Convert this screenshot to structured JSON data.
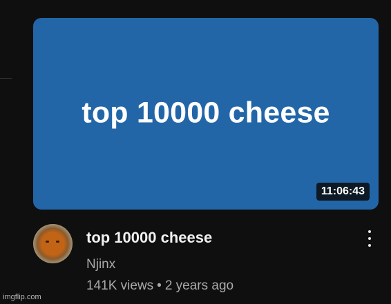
{
  "video": {
    "thumbnail_text": "top 10000 cheese",
    "thumbnail_color": "#2366a8",
    "duration": "11:06:43",
    "title": "top 10000 cheese",
    "channel": "Njinx",
    "views": "141K views",
    "separator": "•",
    "age": "2 years ago"
  },
  "icons": {
    "avatar": "channel-avatar",
    "menu": "more-vert-icon"
  },
  "watermark": "imgflip.com"
}
